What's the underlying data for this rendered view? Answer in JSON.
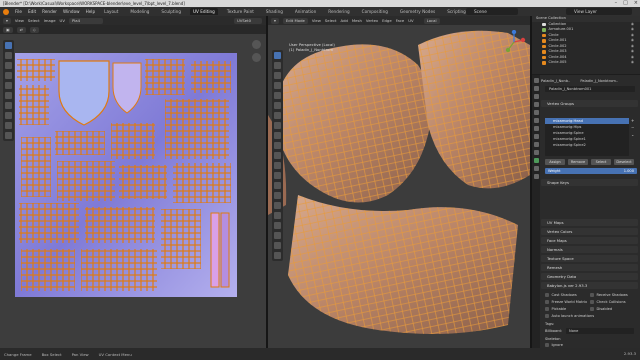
{
  "window": {
    "title": "[Blender* [D:\\Work\\Casual\\Workspace\\WORKSPACE-blender\\eve_level_7\\bpt_level_7.blend]"
  },
  "menu": {
    "items": [
      "File",
      "Edit",
      "Render",
      "Window",
      "Help"
    ],
    "workspaces": [
      "Layout",
      "Modeling",
      "Sculpting",
      "UV Editing",
      "Texture Paint",
      "Shading",
      "Animation",
      "Rendering",
      "Compositing",
      "Geometry Nodes",
      "Scripting"
    ],
    "active_workspace": "UV Editing",
    "scene": "Scene",
    "view_layer": "View Layer"
  },
  "uv_editor": {
    "menus": [
      "View",
      "Select",
      "Image",
      "UV"
    ],
    "image_name": "Pla4",
    "uv_map": "UVSet0"
  },
  "viewport": {
    "mode": "Edit Mode",
    "menus": [
      "View",
      "Select",
      "Add",
      "Mesh",
      "Vertex",
      "Edge",
      "Face",
      "UV"
    ],
    "transform": "Local",
    "view_name": "User Perspective (Local)",
    "object_label": "(1) Paladin_J_Nonbtrom"
  },
  "outliner": {
    "title": "Scene Collection",
    "rows": [
      {
        "label": "Collection",
        "type": "collection"
      },
      {
        "label": "Armature.001",
        "type": "armature"
      },
      {
        "label": "Circle",
        "type": "mesh"
      },
      {
        "label": "Circle.001",
        "type": "mesh"
      },
      {
        "label": "Circle.002",
        "type": "mesh"
      },
      {
        "label": "Circle.003",
        "type": "mesh"
      },
      {
        "label": "Circle.004",
        "type": "mesh"
      },
      {
        "label": "Circle.005",
        "type": "mesh"
      }
    ]
  },
  "properties": {
    "breadcrumb": [
      "Paladin_J_Nonb..",
      "Paladin_J_Nonbtrom.."
    ],
    "data_name": "Paladin_J_Nonbtrom001",
    "vertex_groups_header": "Vertex Groups",
    "vertex_groups": [
      "mixamorig:Head",
      "mixamorig:Hips",
      "mixamorig:Spine",
      "mixamorig:Spine1",
      "mixamorig:Spine2"
    ],
    "selected_group_index": 0,
    "group_buttons": [
      "Assign",
      "Remove",
      "Select",
      "Deselect"
    ],
    "weight_label": "Weight",
    "weight_value": "1.000",
    "panels": [
      "Shape Keys",
      "UV Maps",
      "Vertex Colors",
      "Face Maps",
      "Normals",
      "Texture Space",
      "Remesh",
      "Geometry Data",
      "Babylon.js ver 2.93.3"
    ],
    "checkboxes": [
      {
        "label": "Cast Shadows",
        "checked": false
      },
      {
        "label": "Receive Shadows",
        "checked": false
      },
      {
        "label": "Freeze World Matrix",
        "checked": false
      },
      {
        "label": "Check Collisions",
        "checked": false
      },
      {
        "label": "Pickable",
        "checked": false
      },
      {
        "label": "Disabled",
        "checked": false
      },
      {
        "label": "Auto launch animations",
        "checked": false
      }
    ],
    "tags_label": "Tags:",
    "billboard_label": "Billboard:",
    "billboard_value": "None",
    "skeleton_label": "Skeleton",
    "ignore_label": "Ignore"
  },
  "statusbar": {
    "items": [
      "Change Frame",
      "Box Select",
      "Pan View",
      "UV Context Menu"
    ],
    "version": "2.93.3"
  },
  "colors": {
    "accent": "#4772b3",
    "selection_orange": "#e68a1e",
    "texture": "#7f7ad6"
  }
}
